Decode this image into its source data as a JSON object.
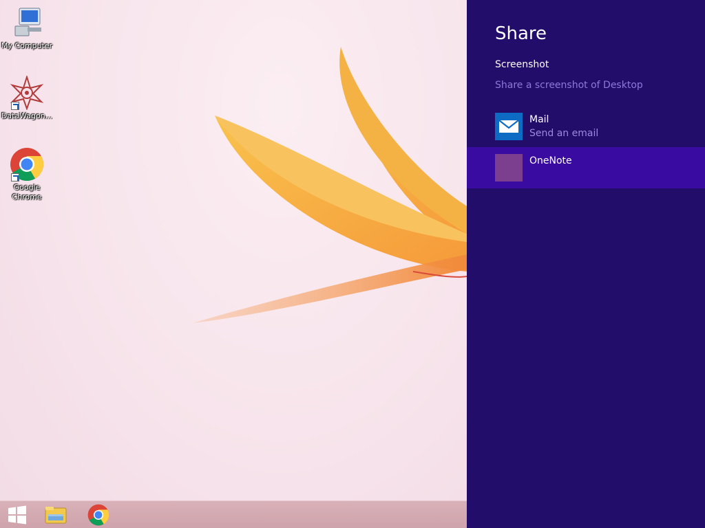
{
  "desktop": {
    "icons": [
      {
        "label": "My Computer",
        "icon": "computer-icon"
      },
      {
        "label": "DataWagon...",
        "icon": "datawagon-icon"
      },
      {
        "label": "Google Chrome",
        "icon": "chrome-icon"
      }
    ]
  },
  "taskbar": {
    "items": [
      {
        "icon": "windows-start-icon"
      },
      {
        "icon": "file-explorer-icon"
      },
      {
        "icon": "chrome-icon"
      }
    ]
  },
  "share_pane": {
    "title": "Share",
    "subtitle": "Screenshot",
    "description": "Share a screenshot of Desktop",
    "targets": [
      {
        "name": "Mail",
        "detail": "Send an email",
        "icon": "mail-icon",
        "tile_color": "#0e6bc4",
        "selected": false
      },
      {
        "name": "OneNote",
        "detail": "",
        "icon": "onenote-icon",
        "tile_color": "#7c3e8e",
        "selected": true
      }
    ],
    "colors": {
      "background": "#220d6b",
      "selected": "#3a0ba0",
      "secondary_text": "#8f79d8"
    }
  }
}
